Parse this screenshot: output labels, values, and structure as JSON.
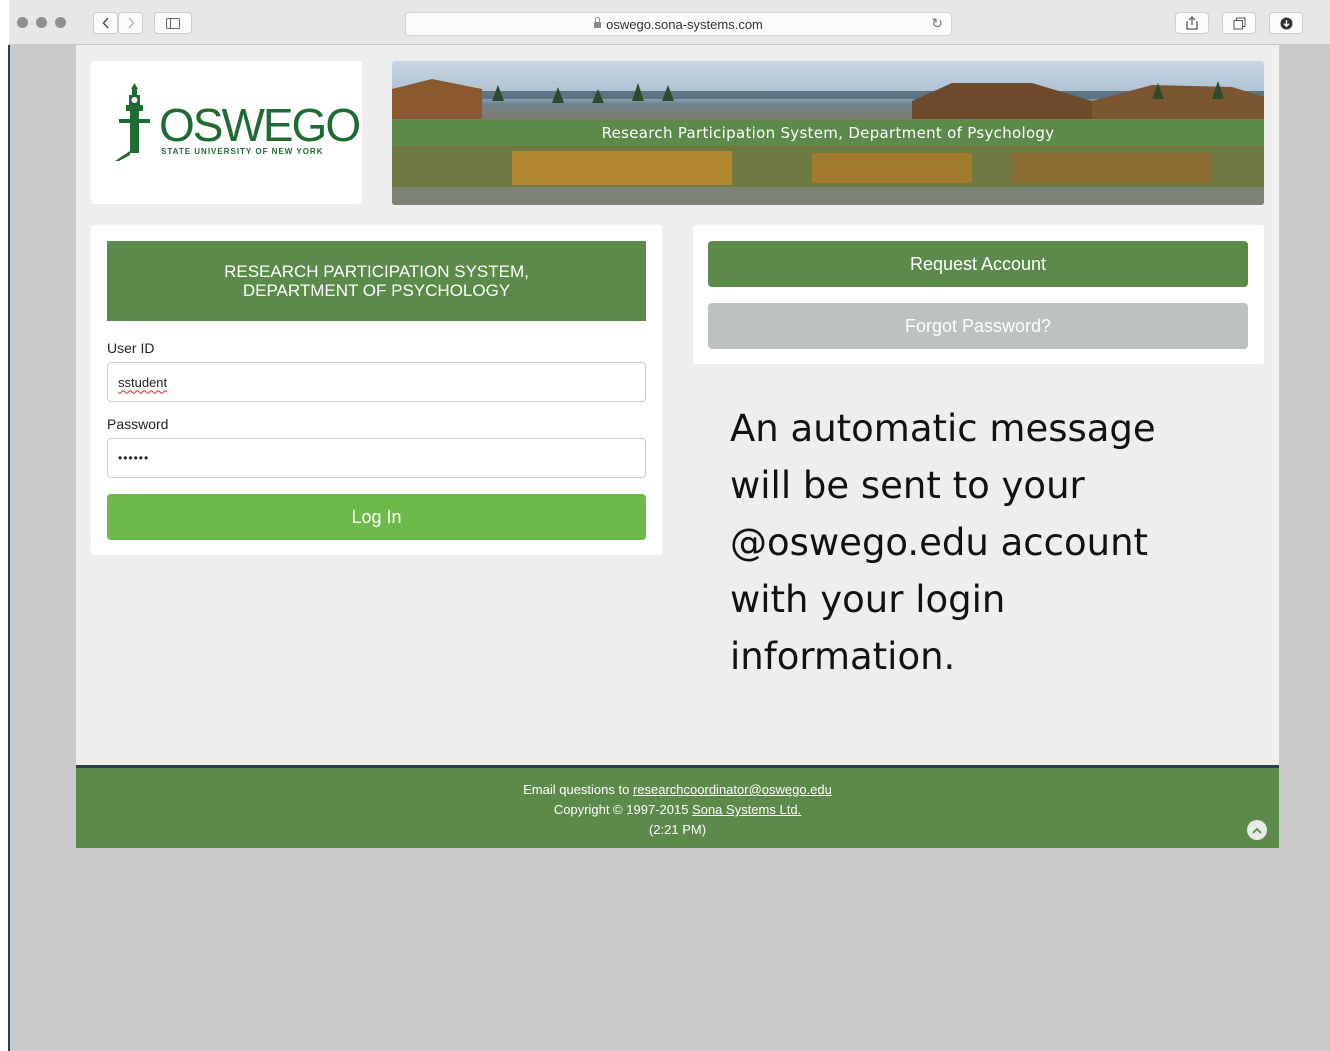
{
  "browser": {
    "url": "oswego.sona-systems.com"
  },
  "logo": {
    "name": "OSWEGO",
    "subtitle": "STATE UNIVERSITY OF NEW YORK"
  },
  "banner": {
    "title": "Research Participation System, Department of Psychology"
  },
  "login": {
    "heading": "RESEARCH PARTICIPATION SYSTEM, DEPARTMENT OF PSYCHOLOGY",
    "user_id_label": "User ID",
    "user_id_value": "sstudent",
    "password_label": "Password",
    "password_value": "••••••",
    "login_button": "Log In"
  },
  "account": {
    "request_button": "Request Account",
    "forgot_button": "Forgot Password?"
  },
  "note": {
    "text": "An automatic message will be sent to your @oswego.edu account with your login information."
  },
  "footer": {
    "email_prefix": "Email questions to ",
    "email": "researchcoordinator@oswego.edu",
    "copyright_prefix": "Copyright © 1997-2015 ",
    "vendor": "Sona Systems Ltd.",
    "time": "(2:21 PM)"
  },
  "colors": {
    "brand_green": "#5b8a4a",
    "login_green": "#6db94c",
    "disabled_gray": "#bcc1c2"
  }
}
